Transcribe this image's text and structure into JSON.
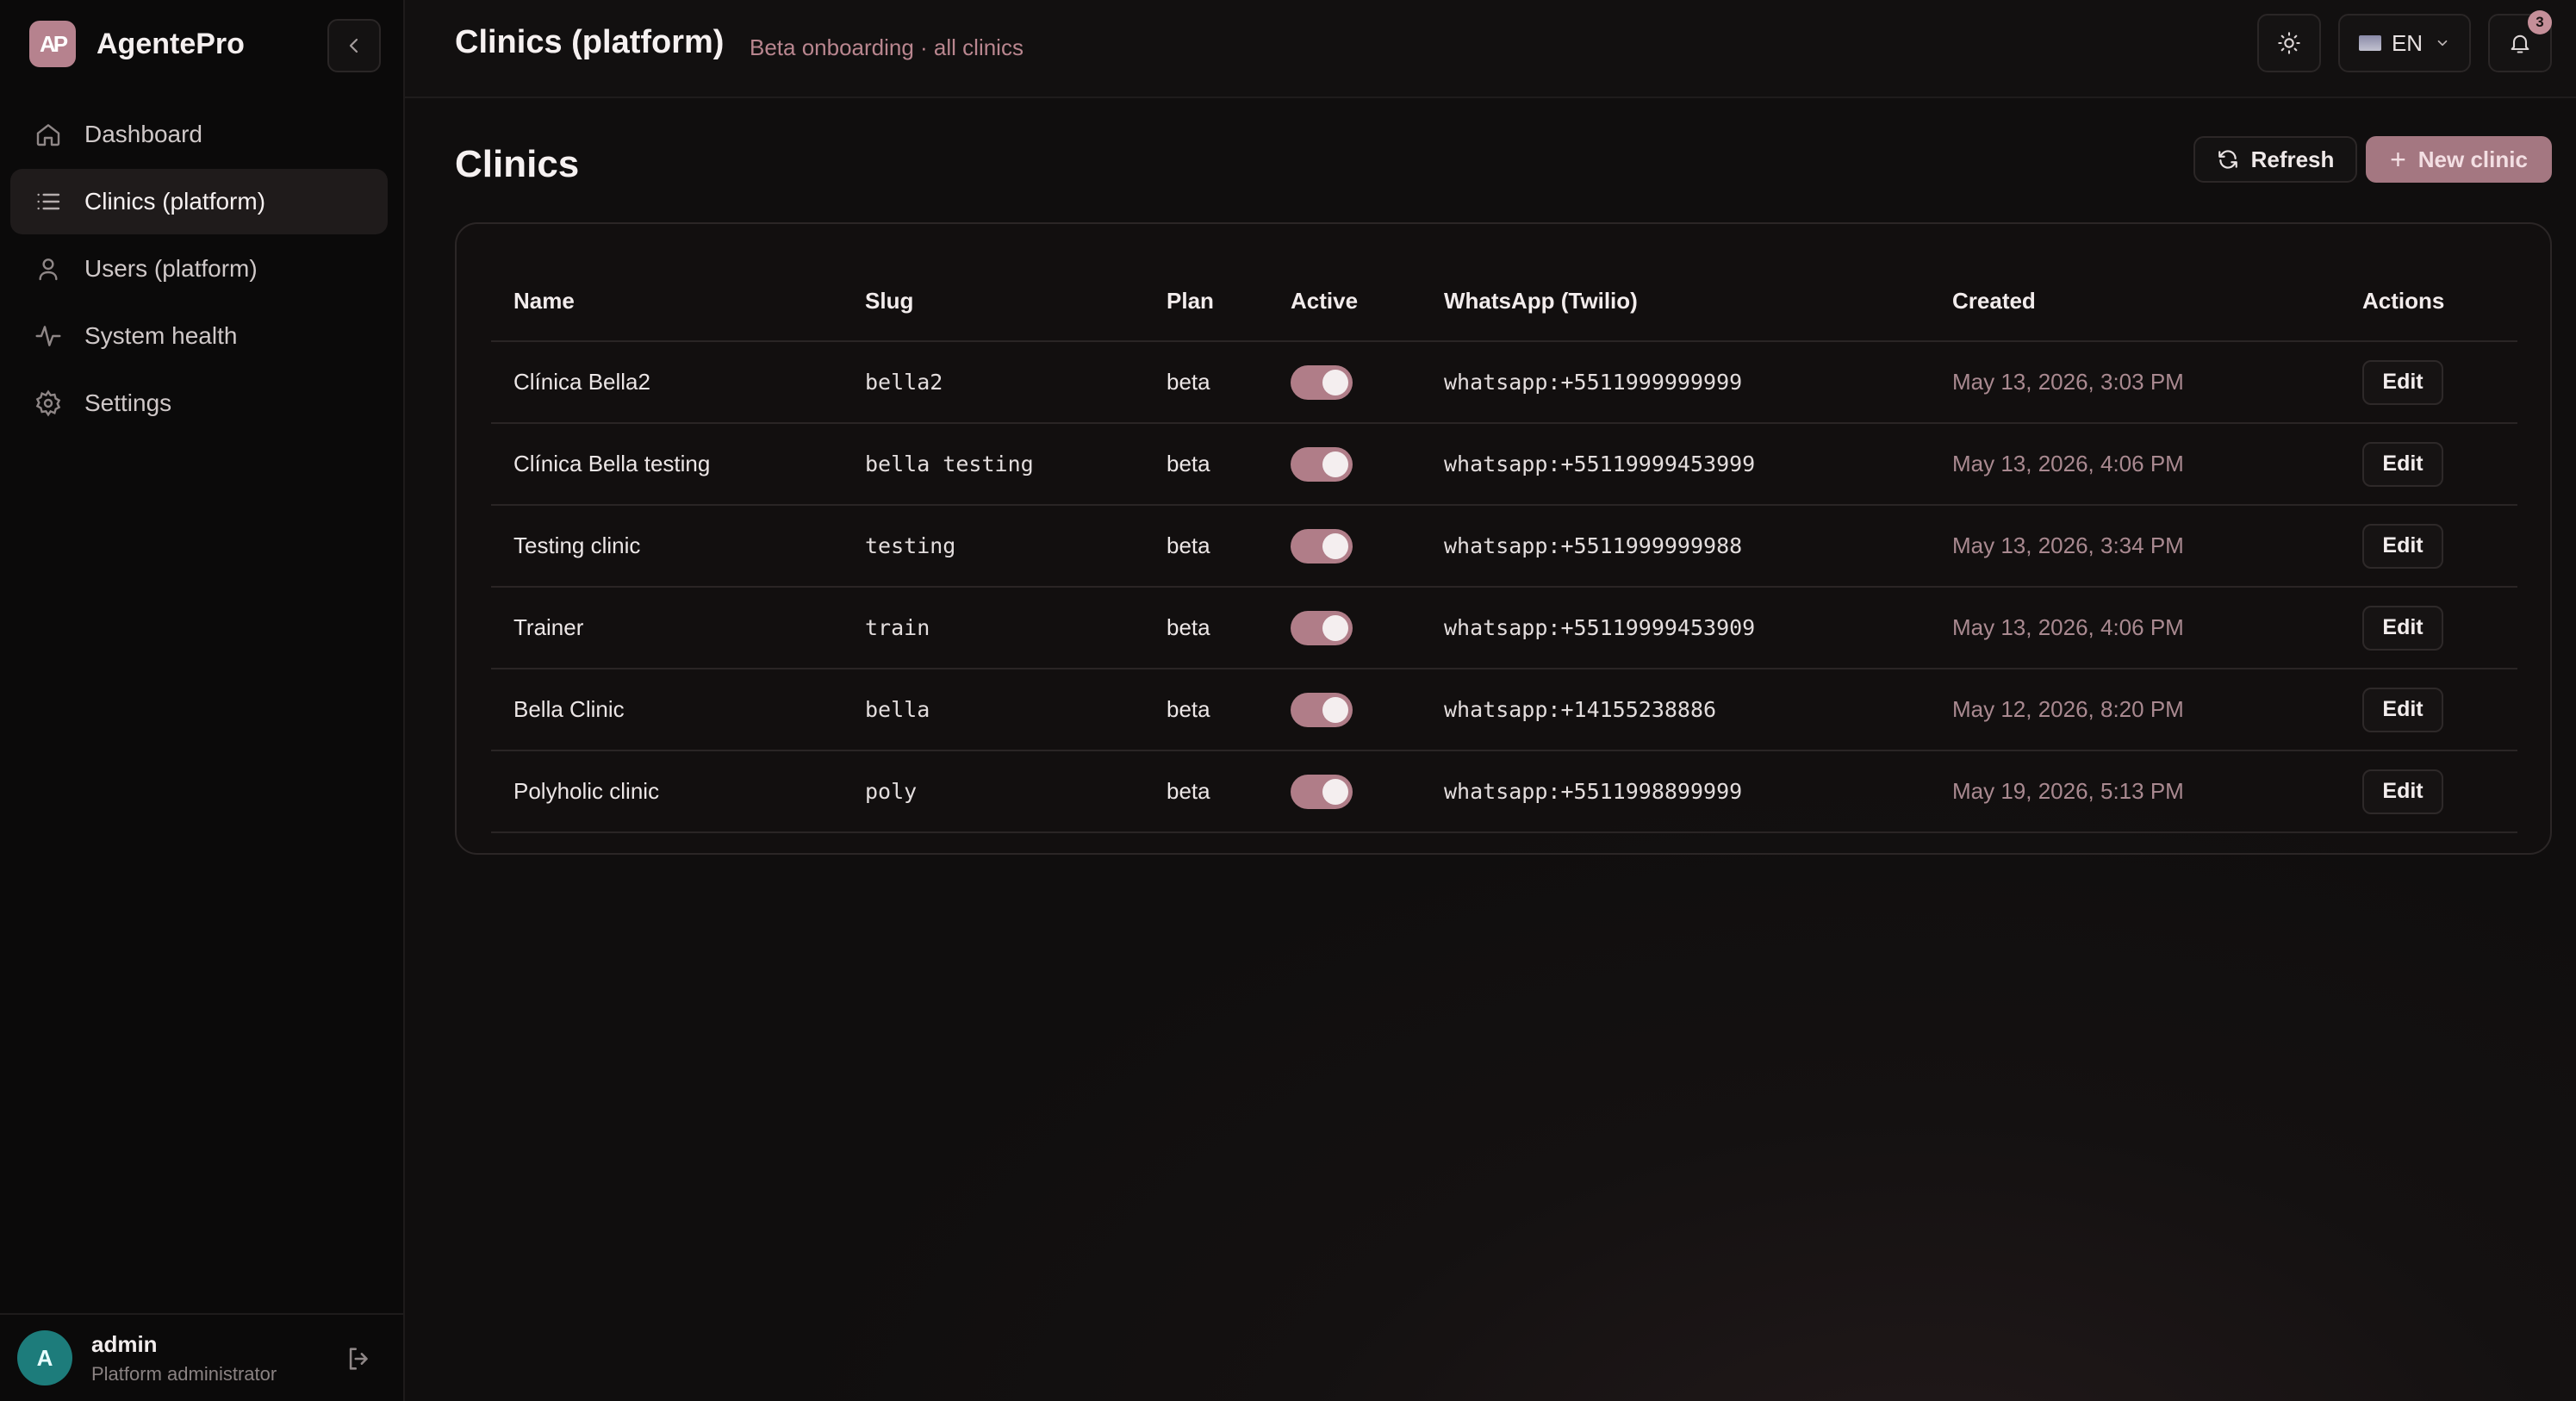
{
  "brand": {
    "name": "AgentePro",
    "logo_text": "AP"
  },
  "sidebar": {
    "items": [
      {
        "label": "Dashboard",
        "icon": "home-icon",
        "active": false
      },
      {
        "label": "Clinics (platform)",
        "icon": "list-icon",
        "active": true
      },
      {
        "label": "Users (platform)",
        "icon": "user-icon",
        "active": false
      },
      {
        "label": "System health",
        "icon": "activity-icon",
        "active": false
      },
      {
        "label": "Settings",
        "icon": "gear-icon",
        "active": false
      }
    ]
  },
  "user": {
    "initial": "A",
    "name": "admin",
    "role": "Platform administrator"
  },
  "header": {
    "title": "Clinics (platform)",
    "subtitle": "Beta onboarding · all clinics",
    "language": "EN",
    "notifications_count": "3"
  },
  "main": {
    "section_title": "Clinics",
    "refresh_label": "Refresh",
    "new_label": "New clinic"
  },
  "table": {
    "columns": [
      "Name",
      "Slug",
      "Plan",
      "Active",
      "WhatsApp (Twilio)",
      "Created",
      "Actions"
    ],
    "rows": [
      {
        "name": "Clínica Bella2",
        "slug": "bella2",
        "plan": "beta",
        "active": true,
        "whatsapp": "whatsapp:+5511999999999",
        "created": "May 13, 2026, 3:03 PM",
        "action": "Edit"
      },
      {
        "name": "Clínica Bella testing",
        "slug": "bella testing",
        "plan": "beta",
        "active": true,
        "whatsapp": "whatsapp:+55119999453999",
        "created": "May 13, 2026, 4:06 PM",
        "action": "Edit"
      },
      {
        "name": "Testing clinic",
        "slug": "testing",
        "plan": "beta",
        "active": true,
        "whatsapp": "whatsapp:+5511999999988",
        "created": "May 13, 2026, 3:34 PM",
        "action": "Edit"
      },
      {
        "name": "Trainer",
        "slug": "train",
        "plan": "beta",
        "active": true,
        "whatsapp": "whatsapp:+55119999453909",
        "created": "May 13, 2026, 4:06 PM",
        "action": "Edit"
      },
      {
        "name": "Bella Clinic",
        "slug": "bella",
        "plan": "beta",
        "active": true,
        "whatsapp": "whatsapp:+14155238886",
        "created": "May 12, 2026, 8:20 PM",
        "action": "Edit"
      },
      {
        "name": "Polyholic clinic",
        "slug": "poly",
        "plan": "beta",
        "active": true,
        "whatsapp": "whatsapp:+5511998899999",
        "created": "May 19, 2026, 5:13 PM",
        "action": "Edit"
      }
    ]
  },
  "colors": {
    "accent": "#b07d88",
    "avatar": "#1d7c7b",
    "subtitle": "#b9868f"
  }
}
